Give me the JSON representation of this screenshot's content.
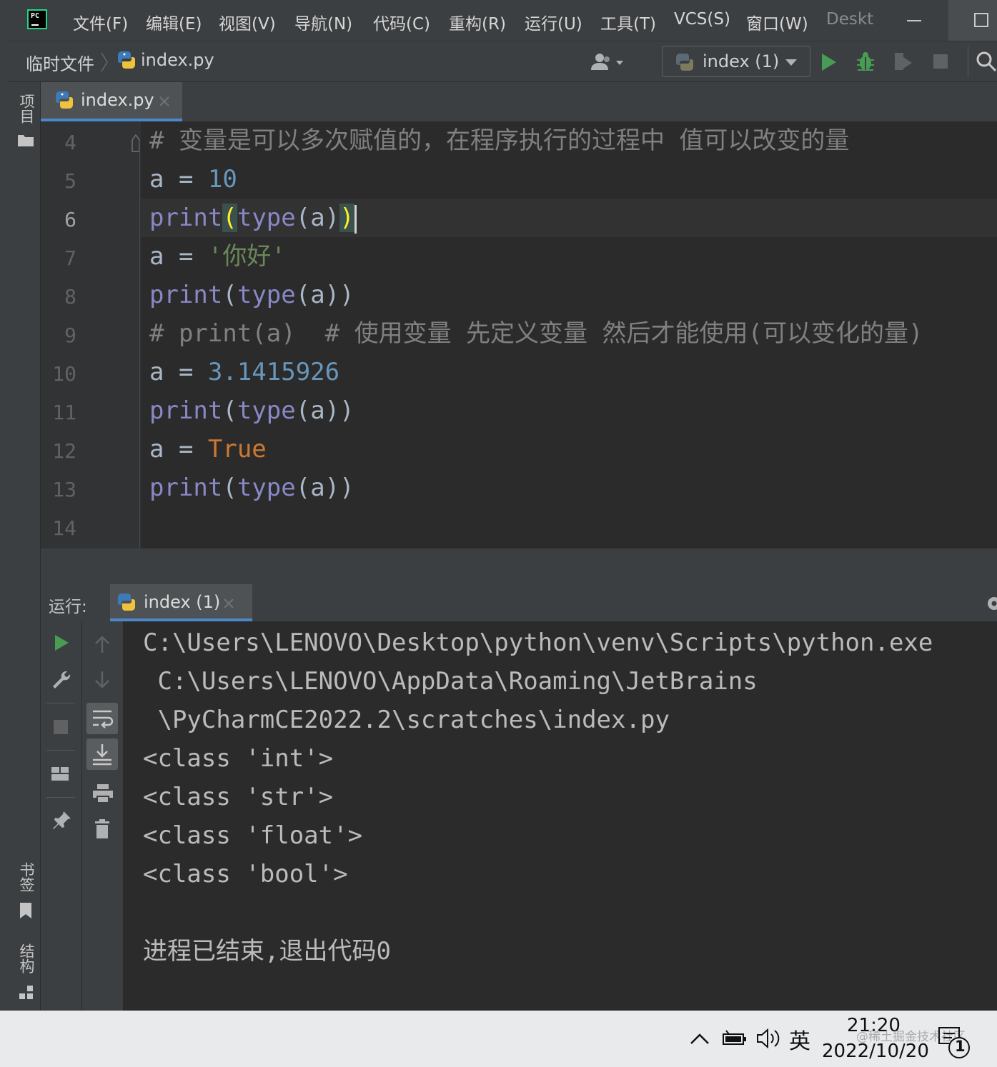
{
  "menubar": {
    "logo_text": "PC",
    "items": [
      "文件(F)",
      "编辑(E)",
      "视图(V)",
      "导航(N)",
      "代码(C)",
      "重构(R)",
      "运行(U)",
      "工具(T)",
      "VCS(S)",
      "窗口(W)",
      "Deskt"
    ]
  },
  "navbar": {
    "breadcrumb_folder": "临时文件",
    "breadcrumb_file": "index.py",
    "run_config": "index (1)"
  },
  "left_strip": {
    "project_label": "项目",
    "bookmarks_label": "书签",
    "structure_label": "结构"
  },
  "editor": {
    "tab_label": "index.py",
    "current_line": 6,
    "lines": [
      {
        "num": "4"
      },
      {
        "num": "5"
      },
      {
        "num": "6"
      },
      {
        "num": "7"
      },
      {
        "num": "8"
      },
      {
        "num": "9"
      },
      {
        "num": "10"
      },
      {
        "num": "11"
      },
      {
        "num": "12"
      },
      {
        "num": "13"
      },
      {
        "num": "14"
      }
    ],
    "code": {
      "l4": "# 变量是可以多次赋值的，在程序执行的过程中 值可以改变的量",
      "l5_a": "a = ",
      "l5_val": "10",
      "l6_print": "print",
      "l6_open": "(",
      "l6_type": "type",
      "l6_arg": "(a)",
      "l6_close": ")",
      "l7_a": "a = ",
      "l7_val": "'你好'",
      "l8_print": "print",
      "l8_open": "(",
      "l8_type": "type",
      "l8_rest": "(a))",
      "l9": "# print(a)  # 使用变量 先定义变量 然后才能使用(可以变化的量)",
      "l10_a": "a = ",
      "l10_val": "3.1415926",
      "l11_print": "print",
      "l11_open": "(",
      "l11_type": "type",
      "l11_rest": "(a))",
      "l12_a": "a = ",
      "l12_val": "True",
      "l13_print": "print",
      "l13_open": "(",
      "l13_type": "type",
      "l13_rest": "(a))"
    }
  },
  "run_panel": {
    "label": "运行:",
    "tab_label": "index (1)",
    "output": [
      "C:\\Users\\LENOVO\\Desktop\\python\\venv\\Scripts\\python.exe",
      " C:\\Users\\LENOVO\\AppData\\Roaming\\JetBrains",
      " \\PyCharmCE2022.2\\scratches\\index.py",
      "<class 'int'>",
      "<class 'str'>",
      "<class 'float'>",
      "<class 'bool'>",
      "",
      "进程已结束,退出代码0"
    ]
  },
  "taskbar": {
    "ime": "英",
    "time": "21:20",
    "date": "2022/10/20",
    "notification_count": "1",
    "watermark": "@稀土掘金技术社区"
  },
  "colors": {
    "accent": "#4a88c7",
    "run_green": "#499c54",
    "editor_bg": "#2b2b2b",
    "panel_bg": "#3c3f41"
  }
}
